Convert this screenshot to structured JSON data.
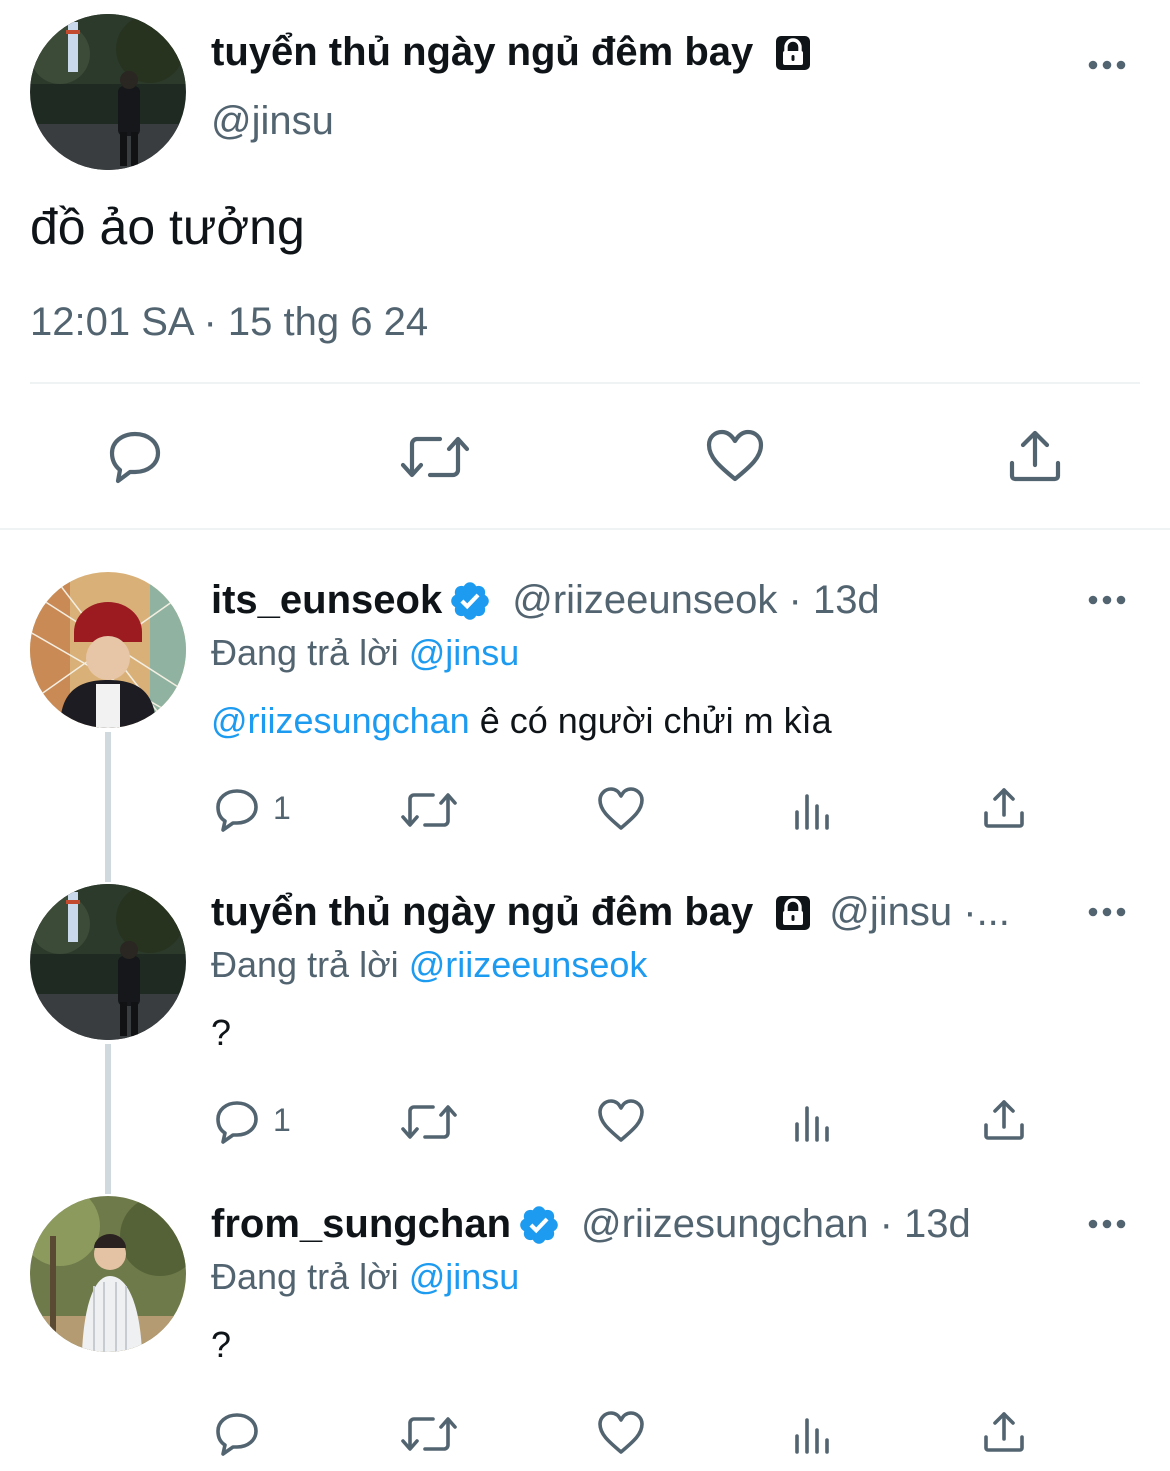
{
  "main_tweet": {
    "display_name": "tuyển thủ ngày ngủ đêm bay",
    "handle": "@jinsu",
    "text": "đồ ảo tưởng",
    "timestamp": "12:01 SA · 15 thg 6 24",
    "icons": [
      "avatar",
      "lock-icon",
      "more-icon",
      "reply-icon",
      "retweet-icon",
      "like-icon",
      "share-icon"
    ]
  },
  "replies": [
    {
      "display_name": "its_eunseok",
      "handle_time": "@riizeeunseok · 13d",
      "replying_prefix": "Đang trả lời",
      "replying_to": "@jinsu",
      "mention": "@riizesungchan",
      "text": " ê có người chửi m kìa",
      "reply_count": "1",
      "verified": true
    },
    {
      "display_name": "tuyển thủ ngày ngủ đêm bay",
      "handle_time": "@jinsu ·...",
      "replying_prefix": "Đang trả lời",
      "replying_to": "@riizeeunseok",
      "text": "?",
      "reply_count": "1",
      "locked": true
    },
    {
      "display_name": "from_sungchan",
      "handle_time": "@riizesungchan · 13d",
      "replying_prefix": "Đang trả lời",
      "replying_to": "@jinsu",
      "text": "?",
      "reply_count": "",
      "verified": true
    }
  ],
  "colors": {
    "accent": "#1d9bf0",
    "text": "#0f1419",
    "secondary": "#536471",
    "divider": "#eff3f4",
    "thread_line": "#cfd9de"
  }
}
